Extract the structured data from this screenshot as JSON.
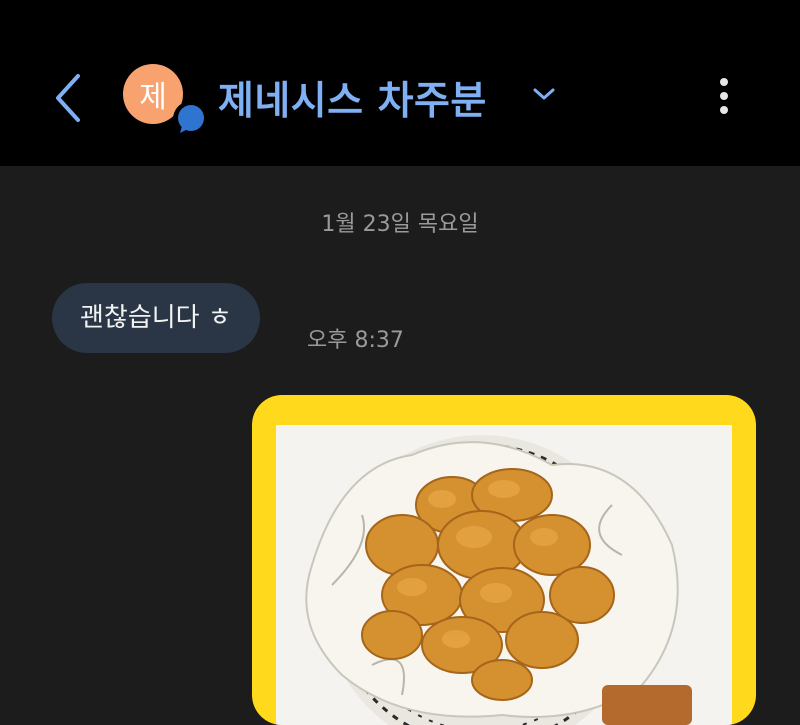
{
  "header": {
    "avatar_char": "제",
    "title": "제네시스 차주분"
  },
  "chat": {
    "date": "1월 23일 목요일",
    "messages": [
      {
        "text": "괜찮습니다 ㅎ",
        "time": "오후 8:37"
      }
    ]
  },
  "icons": [
    "back-icon",
    "chat-badge-icon",
    "chevron-down-icon",
    "more-vert-icon"
  ],
  "colors": {
    "header_bg": "#000000",
    "chat_bg": "#1c1c1c",
    "title": "#7fb0f3",
    "avatar": "#f7a26f",
    "bubble": "#2a3645",
    "image_frame": "#ffd91c"
  }
}
